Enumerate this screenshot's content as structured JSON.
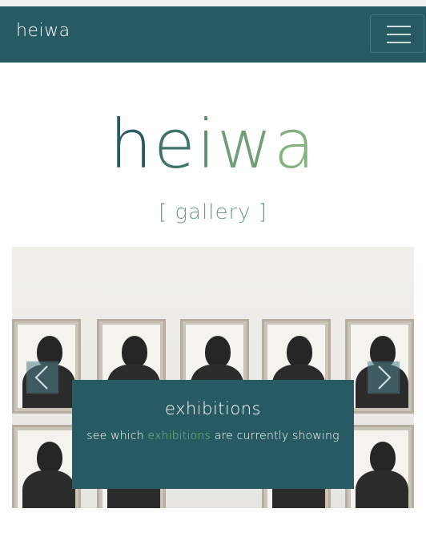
{
  "navbar": {
    "brand": "heiwa",
    "toggler_icon": "hamburger-menu-icon"
  },
  "hero": {
    "logo_letters": [
      "h",
      "e",
      "i",
      "w",
      "a"
    ],
    "logo_colors": [
      "#285a64",
      "#3e7369",
      "#5a8f6f",
      "#6e9f77",
      "#83b27e"
    ],
    "subtitle": "[ gallery ]"
  },
  "carousel": {
    "prev_icon": "chevron-left-icon",
    "next_icon": "chevron-right-icon",
    "slide": {
      "title": "exhibitions",
      "text_before": "see which",
      "link_text": "exhibitions",
      "text_after": "are currently showing"
    }
  },
  "colors": {
    "primary": "#285a64",
    "accent_link": "#7dc286",
    "subtitle": "#6a9b86"
  }
}
